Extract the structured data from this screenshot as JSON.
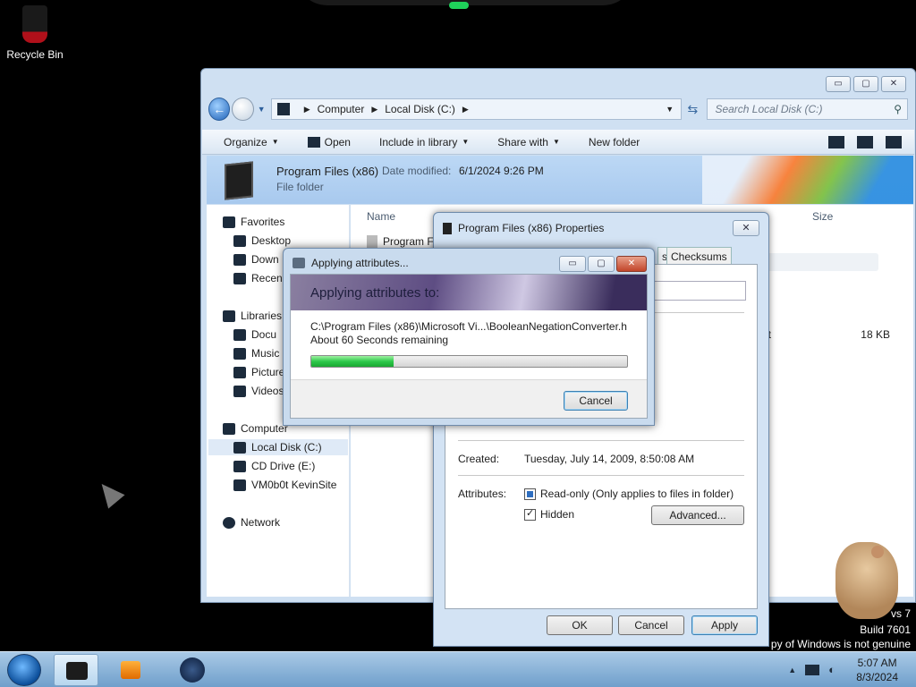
{
  "desktop": {
    "recycle_bin_label": "Recycle Bin",
    "watermark_line1": "vs 7",
    "watermark_line2": "Build 7601",
    "watermark_line3": "py of Windows is not genuine"
  },
  "explorer": {
    "address": {
      "segments": [
        "Computer",
        "Local Disk (C:)"
      ]
    },
    "search_placeholder": "Search Local Disk (C:)",
    "toolbar": {
      "organize": "Organize",
      "open": "Open",
      "include_in_library": "Include in library",
      "share_with": "Share with",
      "new_folder": "New folder"
    },
    "details": {
      "name": "Program Files (x86)",
      "date_label": "Date modified:",
      "date_value": "6/1/2024 9:26 PM",
      "type": "File folder"
    },
    "nav": {
      "favorites": "Favorites",
      "desktop": "Desktop",
      "downloads": "Down",
      "recent": "Recen",
      "libraries": "Libraries",
      "documents": "Docu",
      "music": "Music",
      "pictures": "Picture",
      "videos": "Videos",
      "computer": "Computer",
      "local_disk": "Local Disk (C:)",
      "cd_drive": "CD Drive (E:)",
      "network_drive": "VM0b0t KevinSite",
      "network": "Network"
    },
    "columns": {
      "name": "Name",
      "size": "Size"
    },
    "row_name": "Program F",
    "row_type_fragment": "nt",
    "row_size": "18 KB"
  },
  "properties": {
    "title": "Program Files (x86) Properties",
    "tab_checksums": "Checksums",
    "tab_fragment": "s",
    "created_label": "Created:",
    "created_value": "Tuesday, July 14, 2009, 8:50:08 AM",
    "attributes_label": "Attributes:",
    "readonly_label": "Read-only (Only applies to files in folder)",
    "hidden_label": "Hidden",
    "advanced_button": "Advanced...",
    "ok_button": "OK",
    "cancel_button": "Cancel",
    "apply_button": "Apply"
  },
  "applying": {
    "title": "Applying attributes...",
    "banner": "Applying attributes to:",
    "path": "C:\\Program Files (x86)\\Microsoft Vi...\\BooleanNegationConverter.h",
    "remaining": "About 60 Seconds remaining",
    "progress_fraction": 0.26,
    "cancel_button": "Cancel"
  },
  "taskbar": {
    "time": "5:07 AM",
    "date": "8/3/2024"
  },
  "colors": {
    "progress": "#2ec94a",
    "taskbar": "#8fb6da",
    "dialog_frame": "#c9dbee"
  }
}
